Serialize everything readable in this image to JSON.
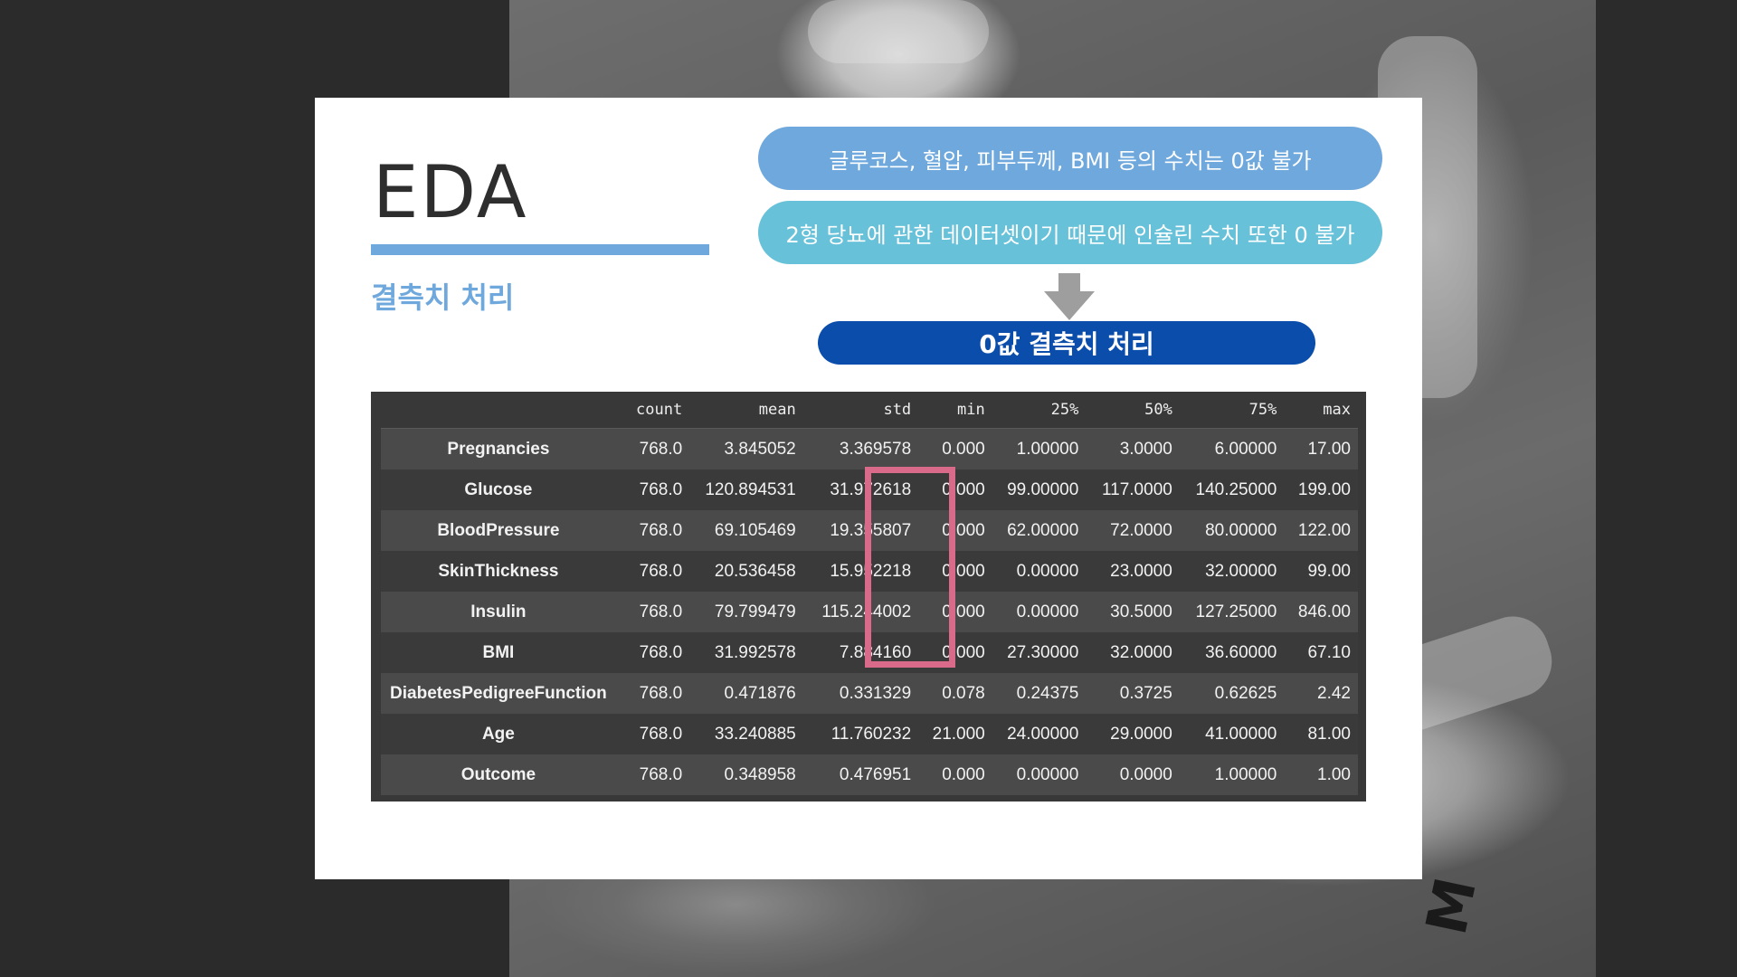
{
  "slide": {
    "title": "EDA",
    "subtitle": "결측치 처리",
    "notes": [
      "글루코스, 혈압, 피부두께, BMI 등의 수치는 0값 불가",
      "2형 당뇨에 관한 데이터셋이기 때문에 인슐린 수치 또한 0 불가"
    ],
    "result": "0값 결측치 처리",
    "colors": {
      "accent": "#6fa8dc",
      "pill2": "#67c1d9",
      "result": "#0b4dab",
      "highlight": "#d96a8a",
      "table_bg": "#383838"
    }
  },
  "table": {
    "columns": [
      "",
      "count",
      "mean",
      "std",
      "min",
      "25%",
      "50%",
      "75%",
      "max"
    ],
    "rows": [
      [
        "Pregnancies",
        "768.0",
        "3.845052",
        "3.369578",
        "0.000",
        "1.00000",
        "3.0000",
        "6.00000",
        "17.00"
      ],
      [
        "Glucose",
        "768.0",
        "120.894531",
        "31.972618",
        "0.000",
        "99.00000",
        "117.0000",
        "140.25000",
        "199.00"
      ],
      [
        "BloodPressure",
        "768.0",
        "69.105469",
        "19.355807",
        "0.000",
        "62.00000",
        "72.0000",
        "80.00000",
        "122.00"
      ],
      [
        "SkinThickness",
        "768.0",
        "20.536458",
        "15.952218",
        "0.000",
        "0.00000",
        "23.0000",
        "32.00000",
        "99.00"
      ],
      [
        "Insulin",
        "768.0",
        "79.799479",
        "115.244002",
        "0.000",
        "0.00000",
        "30.5000",
        "127.25000",
        "846.00"
      ],
      [
        "BMI",
        "768.0",
        "31.992578",
        "7.884160",
        "0.000",
        "27.30000",
        "32.0000",
        "36.60000",
        "67.10"
      ],
      [
        "DiabetesPedigreeFunction",
        "768.0",
        "0.471876",
        "0.331329",
        "0.078",
        "0.24375",
        "0.3725",
        "0.62625",
        "2.42"
      ],
      [
        "Age",
        "768.0",
        "33.240885",
        "11.760232",
        "21.000",
        "24.00000",
        "29.0000",
        "41.00000",
        "81.00"
      ],
      [
        "Outcome",
        "768.0",
        "0.348958",
        "0.476951",
        "0.000",
        "0.00000",
        "0.0000",
        "1.00000",
        "1.00"
      ]
    ]
  },
  "background": {
    "photo_letter": "M"
  }
}
